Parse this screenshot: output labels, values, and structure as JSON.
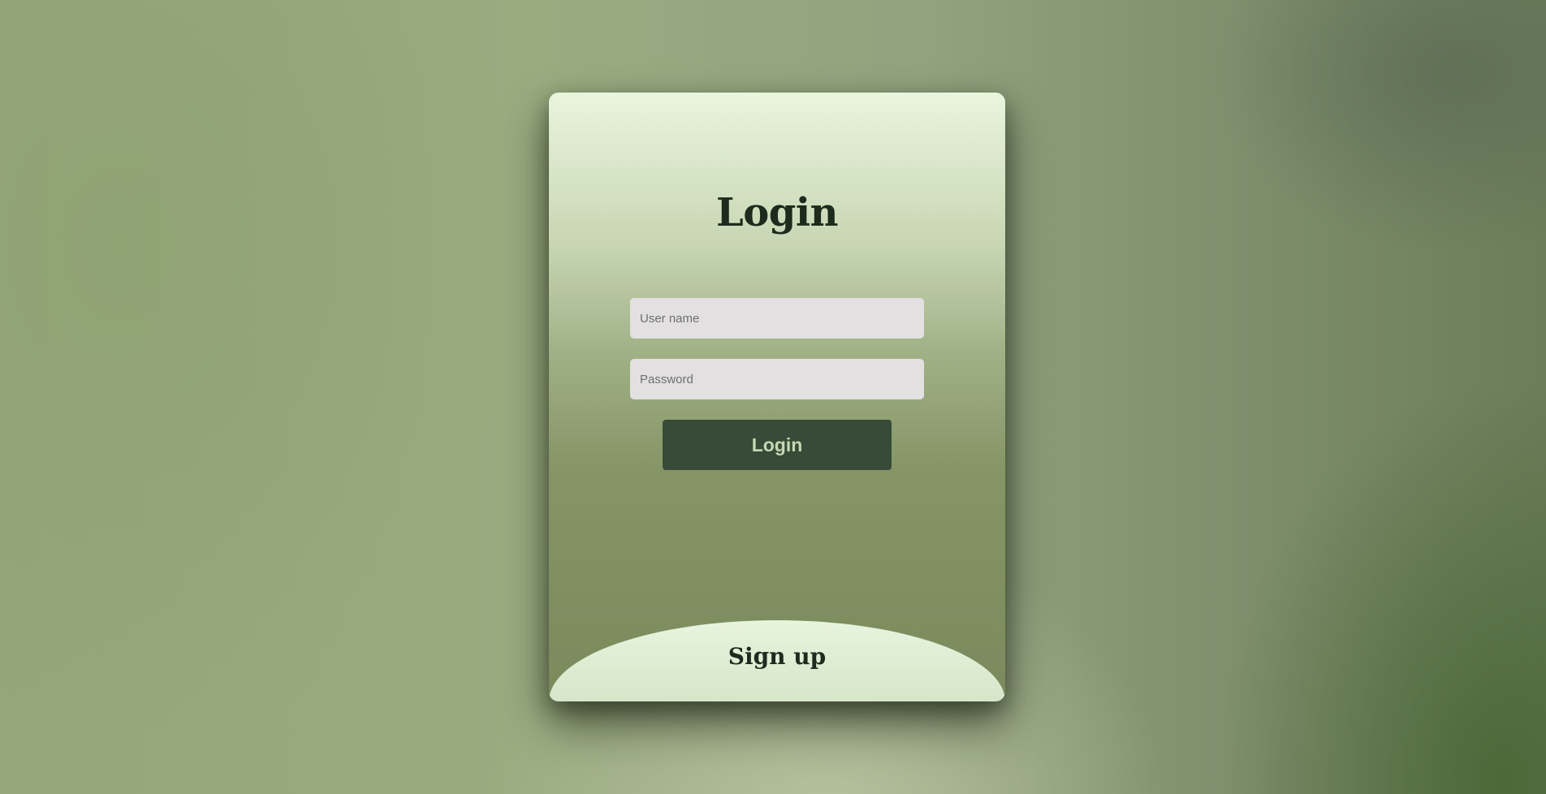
{
  "login_form": {
    "title": "Login",
    "username_placeholder": "User name",
    "password_placeholder": "Password",
    "submit_label": "Login"
  },
  "signup": {
    "label": "Sign up"
  },
  "colors": {
    "button_bg": "#384b38",
    "button_text": "#c5d8b3",
    "input_bg": "#e2e0e1",
    "title_text": "#1c2b1c"
  }
}
